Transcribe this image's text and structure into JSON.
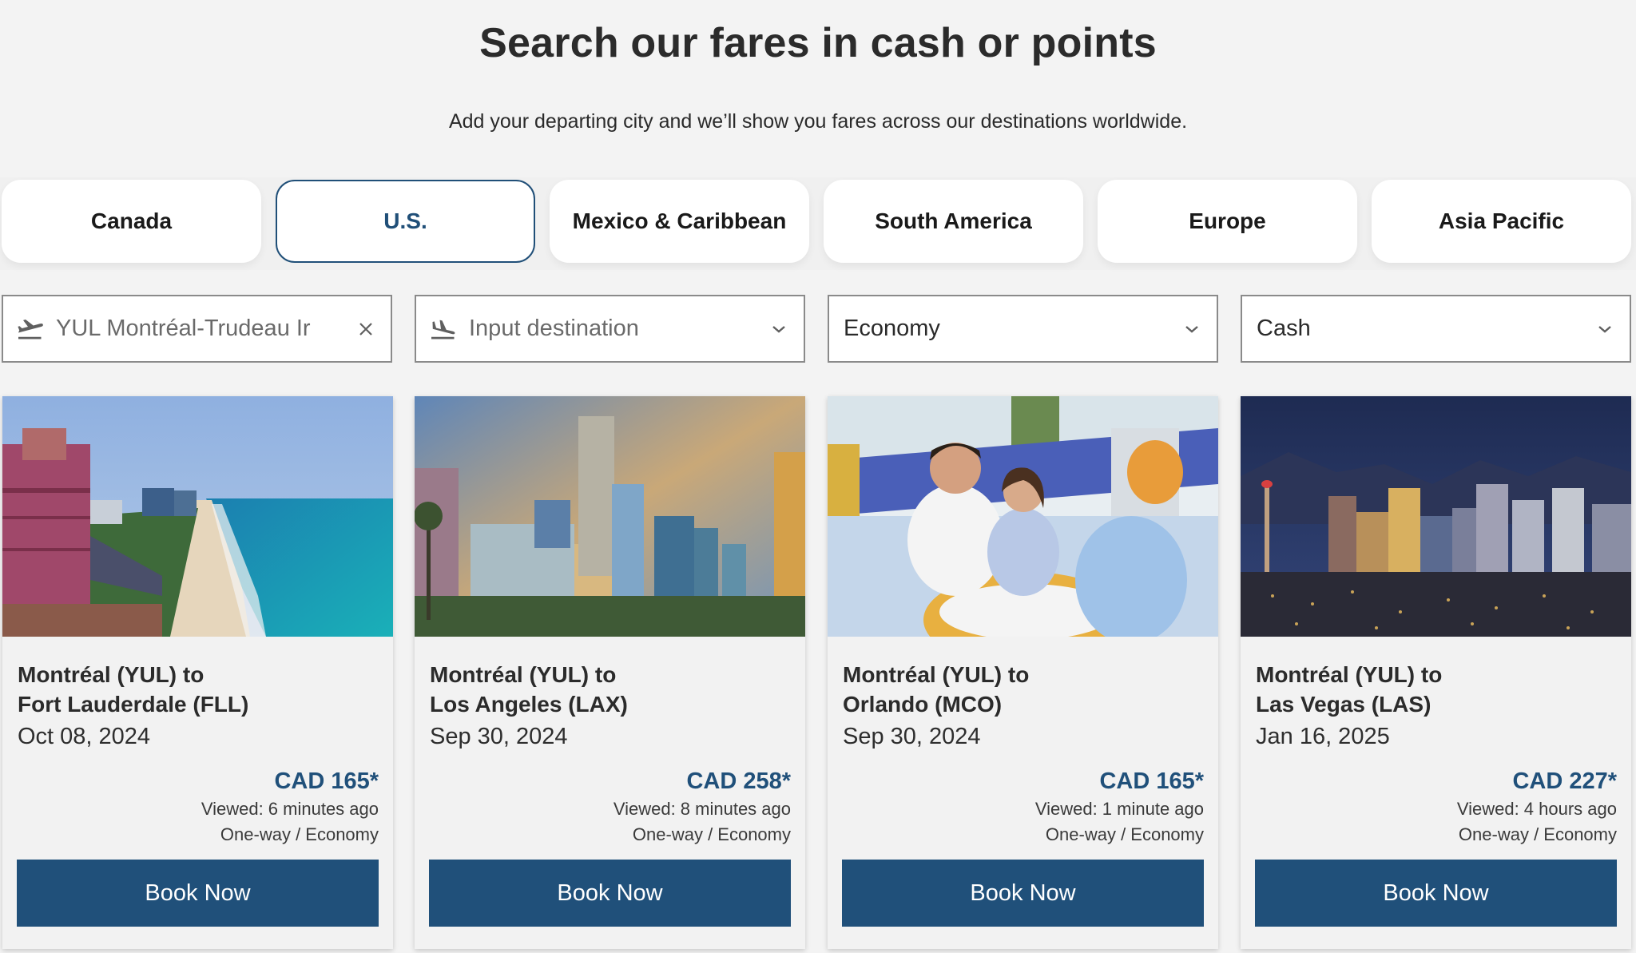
{
  "header": {
    "title": "Search our fares in cash or points",
    "subtitle": "Add your departing city and we’ll show you fares across our destinations worldwide."
  },
  "region_tabs": [
    {
      "label": "Canada",
      "active": false
    },
    {
      "label": "U.S.",
      "active": true
    },
    {
      "label": "Mexico & Caribbean",
      "active": false
    },
    {
      "label": "South America",
      "active": false
    },
    {
      "label": "Europe",
      "active": false
    },
    {
      "label": "Asia Pacific",
      "active": false
    }
  ],
  "search": {
    "origin": {
      "value": "YUL Montréal-Trudeau Ir",
      "icon": "plane-departure-icon",
      "clear_icon": "close-icon"
    },
    "destination": {
      "placeholder": "Input destination",
      "icon": "plane-arrival-icon",
      "dropdown_icon": "chevron-down-icon"
    },
    "cabin": {
      "value": "Economy",
      "dropdown_icon": "chevron-down-icon"
    },
    "payment": {
      "value": "Cash",
      "dropdown_icon": "chevron-down-icon"
    }
  },
  "colors": {
    "brand": "#20507a",
    "background": "#f3f3f3"
  },
  "fares": [
    {
      "route_line1": "Montréal (YUL) to",
      "route_line2": "Fort Lauderdale (FLL)",
      "date": "Oct 08, 2024",
      "price": "CAD 165*",
      "viewed": "Viewed: 6 minutes ago",
      "trip": "One-way / Economy",
      "button": "Book Now",
      "image": "Fort Lauderdale beach skyline"
    },
    {
      "route_line1": "Montréal (YUL) to",
      "route_line2": "Los Angeles (LAX)",
      "date": "Sep 30, 2024",
      "price": "CAD 258*",
      "viewed": "Viewed: 8 minutes ago",
      "trip": "One-way / Economy",
      "button": "Book Now",
      "image": "Los Angeles downtown skyline"
    },
    {
      "route_line1": "Montréal (YUL) to",
      "route_line2": "Orlando (MCO)",
      "date": "Sep 30, 2024",
      "price": "CAD 165*",
      "viewed": "Viewed: 1 minute ago",
      "trip": "One-way / Economy",
      "button": "Book Now",
      "image": "Father and daughter on theme park ride"
    },
    {
      "route_line1": "Montréal (YUL) to",
      "route_line2": "Las Vegas (LAS)",
      "date": "Jan 16, 2025",
      "price": "CAD 227*",
      "viewed": "Viewed: 4 hours ago",
      "trip": "One-way / Economy",
      "button": "Book Now",
      "image": "Las Vegas night skyline"
    }
  ]
}
